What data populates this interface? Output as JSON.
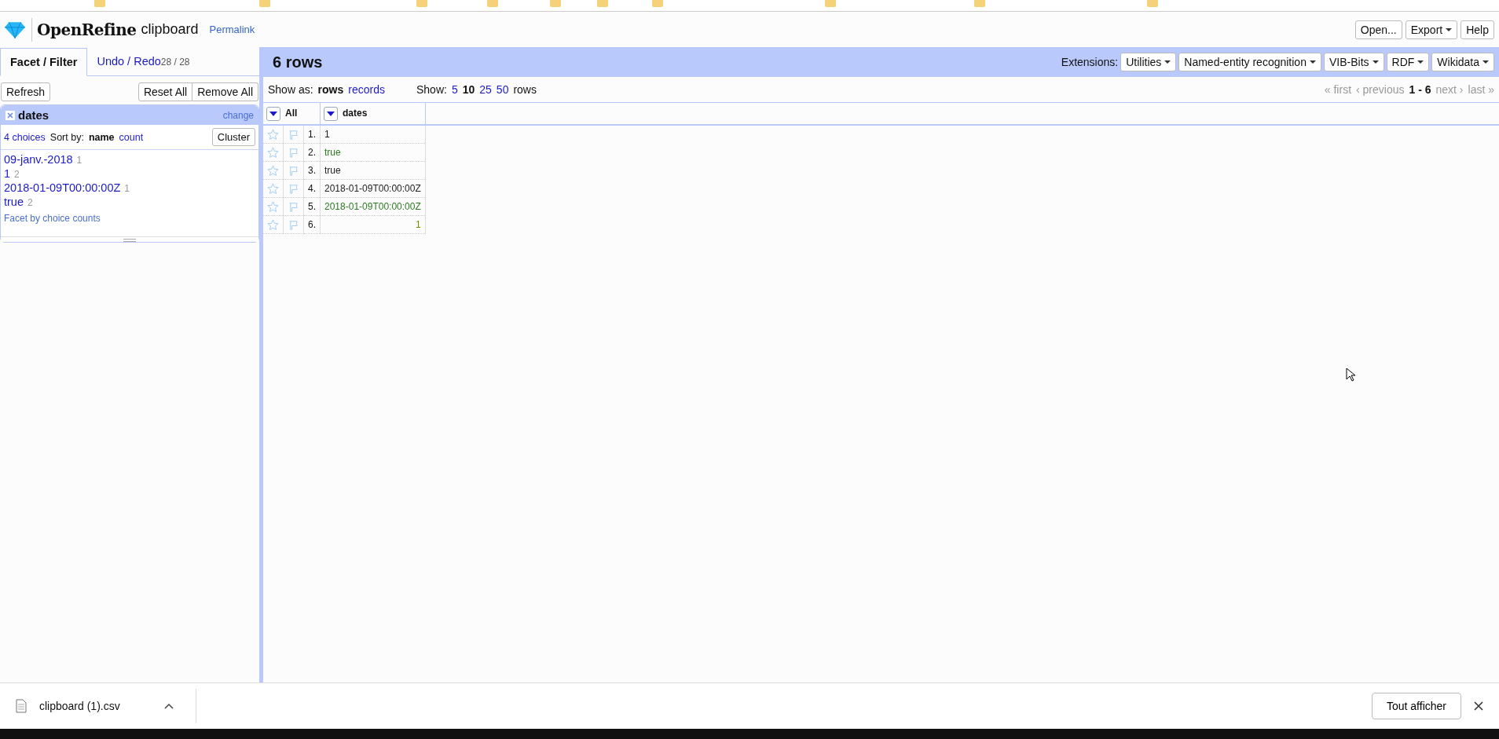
{
  "header": {
    "app_name": "OpenRefine",
    "project_name": "clipboard",
    "permalink": "Permalink",
    "buttons": [
      {
        "label": "Open...",
        "dropdown": false
      },
      {
        "label": "Export",
        "dropdown": true
      },
      {
        "label": "Help",
        "dropdown": false
      }
    ]
  },
  "left_tabs": [
    {
      "label": "Facet / Filter",
      "selected": true
    },
    {
      "label": "Undo / Redo",
      "count": "28 / 28",
      "selected": false
    }
  ],
  "facet_toolbar": {
    "refresh": "Refresh",
    "reset_all": "Reset All",
    "remove_all": "Remove All"
  },
  "facet": {
    "title": "dates",
    "change": "change",
    "choices_count": "4 choices",
    "sort_by": "Sort by:",
    "sort_options": [
      {
        "label": "name",
        "selected": true
      },
      {
        "label": "count",
        "selected": false
      }
    ],
    "cluster": "Cluster",
    "choices": [
      {
        "label": "09-janv.-2018",
        "count": "1"
      },
      {
        "label": "1",
        "count": "2"
      },
      {
        "label": "2018-01-09T00:00:00Z",
        "count": "1"
      },
      {
        "label": "true",
        "count": "2"
      }
    ],
    "footer_link": "Facet by choice counts"
  },
  "summary": {
    "title": "6 rows",
    "extensions_label": "Extensions:",
    "extensions": [
      "Utilities",
      "Named-entity recognition",
      "VIB-Bits",
      "RDF",
      "Wikidata"
    ]
  },
  "view_bar": {
    "show_as_label": "Show as:",
    "modes": [
      {
        "label": "rows",
        "selected": true
      },
      {
        "label": "records",
        "selected": false
      }
    ],
    "show_label": "Show:",
    "page_sizes": [
      {
        "label": "5",
        "selected": false
      },
      {
        "label": "10",
        "selected": true
      },
      {
        "label": "25",
        "selected": false
      },
      {
        "label": "50",
        "selected": false
      }
    ],
    "rows_label": "rows",
    "pager": {
      "first": "« first",
      "previous": "‹ previous",
      "range": "1 - 6",
      "next": "next ›",
      "last": "last »"
    }
  },
  "table": {
    "columns": [
      "All",
      "dates"
    ],
    "rows": [
      {
        "index": "1.",
        "value": "1",
        "kind": "text"
      },
      {
        "index": "2.",
        "value": "true",
        "kind": "boolean"
      },
      {
        "index": "3.",
        "value": "true",
        "kind": "text"
      },
      {
        "index": "4.",
        "value": "2018-01-09T00:00:00Z",
        "kind": "text"
      },
      {
        "index": "5.",
        "value": "2018-01-09T00:00:00Z",
        "kind": "date"
      },
      {
        "index": "6.",
        "value": "1",
        "kind": "number"
      }
    ]
  },
  "download_bar": {
    "file_name": "clipboard (1).csv",
    "show_all": "Tout afficher"
  }
}
